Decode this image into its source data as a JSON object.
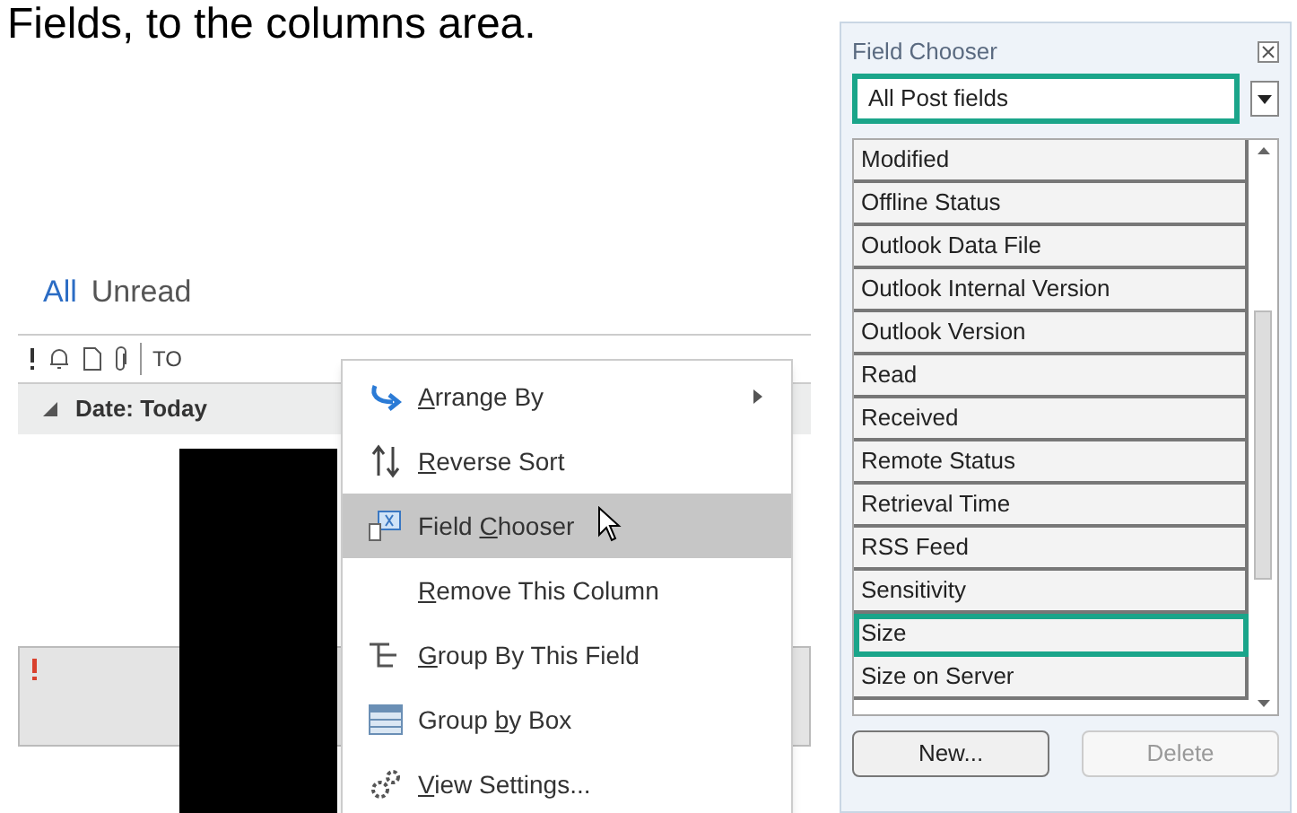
{
  "caption": "Fields, to the columns area.",
  "mail_view": {
    "filters": [
      {
        "label": "All",
        "selected": true
      },
      {
        "label": "Unread",
        "selected": false
      }
    ],
    "column_header": {
      "to_label": "TO"
    },
    "group_header": {
      "label": "Date: Today",
      "expanded": true
    },
    "message_row": {
      "important": true
    }
  },
  "context_menu": {
    "items": [
      {
        "kind": "arrange",
        "access_key": "A",
        "after": "rrange By",
        "submenu": true,
        "highlighted": false
      },
      {
        "kind": "sort",
        "access_key": "R",
        "after": "everse Sort",
        "submenu": false,
        "highlighted": false
      },
      {
        "kind": "chooser",
        "before": "Field ",
        "access_key": "C",
        "after": "hooser",
        "submenu": false,
        "highlighted": true
      },
      {
        "kind": "none",
        "access_key": "R",
        "after": "emove This Column",
        "submenu": false,
        "highlighted": false
      },
      {
        "kind": "group",
        "access_key": "G",
        "after": "roup By This Field",
        "submenu": false,
        "highlighted": false
      },
      {
        "kind": "box",
        "before": "Group ",
        "access_key": "b",
        "after": "y Box",
        "submenu": false,
        "highlighted": false
      },
      {
        "kind": "settings",
        "access_key": "V",
        "after": "iew Settings...",
        "submenu": false,
        "highlighted": false
      }
    ]
  },
  "field_chooser": {
    "title": "Field Chooser",
    "dropdown": {
      "value": "All Post fields",
      "highlighted": true
    },
    "fields": [
      {
        "label": "Modified",
        "highlighted": false
      },
      {
        "label": "Offline Status",
        "highlighted": false
      },
      {
        "label": "Outlook Data File",
        "highlighted": false
      },
      {
        "label": "Outlook Internal Version",
        "highlighted": false
      },
      {
        "label": "Outlook Version",
        "highlighted": false
      },
      {
        "label": "Read",
        "highlighted": false
      },
      {
        "label": "Received",
        "highlighted": false
      },
      {
        "label": "Remote Status",
        "highlighted": false
      },
      {
        "label": "Retrieval Time",
        "highlighted": false
      },
      {
        "label": "RSS Feed",
        "highlighted": false
      },
      {
        "label": "Sensitivity",
        "highlighted": false
      },
      {
        "label": "Size",
        "highlighted": true
      },
      {
        "label": "Size on Server",
        "highlighted": false
      }
    ],
    "buttons": [
      {
        "label": "New...",
        "disabled": false
      },
      {
        "label": "Delete",
        "disabled": true
      }
    ]
  }
}
